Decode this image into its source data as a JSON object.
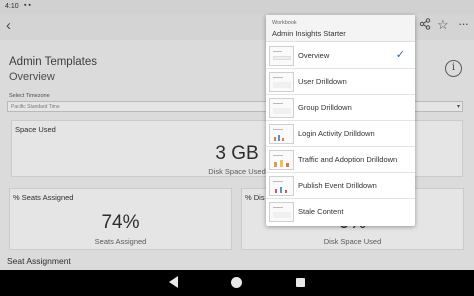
{
  "status": {
    "time": "4:10"
  },
  "page": {
    "title": "Admin Templates",
    "subtitle": "Overview"
  },
  "timezone": {
    "label": "Select Timezone",
    "value": "Pacific Standard Time"
  },
  "cards": {
    "space_used": {
      "title": "Space Used",
      "value": "3 GB",
      "caption": "Disk Space Used"
    },
    "seats_assigned": {
      "title": "% Seats Assigned",
      "value": "74%",
      "caption": "Seats Assigned"
    },
    "disk": {
      "title": "% Dis",
      "value": "0%",
      "caption": "Disk Space Used"
    }
  },
  "seat_assignment": {
    "title": "Seat Assignment"
  },
  "workbook_menu": {
    "label": "Workbook",
    "name": "Admin Insights Starter",
    "items": [
      {
        "label": "Overview",
        "selected": true
      },
      {
        "label": "User Drilldown",
        "selected": false
      },
      {
        "label": "Group Drilldown",
        "selected": false
      },
      {
        "label": "Login Activity Drilldown",
        "selected": false
      },
      {
        "label": "Traffic and Adoption Drilldown",
        "selected": false
      },
      {
        "label": "Publish Event Drilldown",
        "selected": false
      },
      {
        "label": "Stale Content",
        "selected": false
      }
    ],
    "check_color": "#3367c8"
  },
  "icons": [
    "back-arrow-icon",
    "share-icon",
    "star-icon",
    "more-icon",
    "info-icon",
    "nav-back-icon",
    "nav-home-icon",
    "nav-recents-icon"
  ]
}
